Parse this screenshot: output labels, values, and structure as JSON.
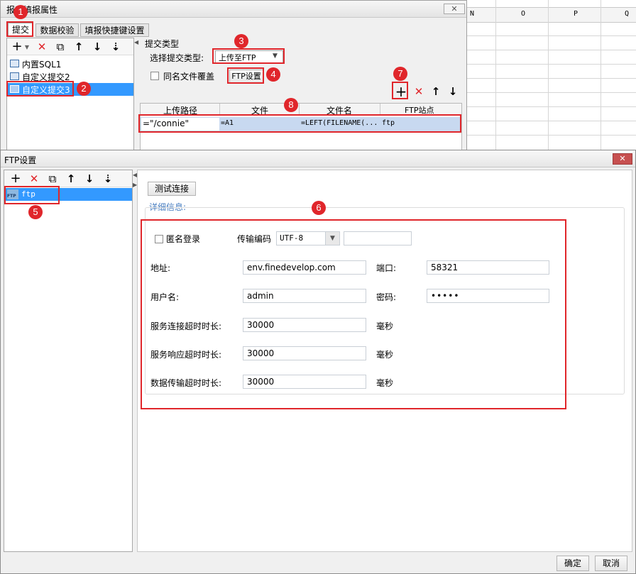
{
  "spreadsheet": {
    "columns": [
      "N",
      "O",
      "P",
      "Q"
    ]
  },
  "prop_dialog": {
    "title": "报表填报属性",
    "tabs": [
      "提交",
      "数据校验",
      "填报快捷键设置"
    ],
    "tree_items": [
      "内置SQL1",
      "自定义提交2",
      "自定义提交3"
    ],
    "section_title": "提交类型",
    "type_label": "选择提交类型:",
    "type_value": "上传至FTP",
    "overwrite_label": "同名文件覆盖",
    "ftp_button": "FTP设置",
    "table_headers": [
      "上传路径",
      "文件",
      "文件名",
      "FTP站点"
    ],
    "row": {
      "path": "=\"/connie\"",
      "file": "=A1",
      "filename": "=LEFT(FILENAME(...",
      "site": "ftp"
    }
  },
  "ftp_dialog": {
    "title": "FTP设置",
    "list_items": [
      {
        "label": "ftp",
        "icon": "ftp-icon"
      }
    ],
    "test_button": "测试连接",
    "detail_title": "详细信息:",
    "anon_label": "匿名登录",
    "encoding_label": "传输编码",
    "encoding_value": "UTF-8",
    "address_label": "地址:",
    "address_value": "env.finedevelop.com",
    "port_label": "端口:",
    "port_value": "58321",
    "user_label": "用户名:",
    "user_value": "admin",
    "password_label": "密码:",
    "password_value": "•••••",
    "connect_timeout_label": "服务连接超时时长:",
    "connect_timeout_value": "30000",
    "response_timeout_label": "服务响应超时时长:",
    "response_timeout_value": "30000",
    "transfer_timeout_label": "数据传输超时时长:",
    "transfer_timeout_value": "30000",
    "unit_label": "毫秒",
    "ok_button": "确定",
    "cancel_button": "取消"
  },
  "callouts": [
    "1",
    "2",
    "3",
    "4",
    "5",
    "6",
    "7",
    "8"
  ],
  "colors": {
    "accent_red": "#e0262b",
    "selection": "#3399ff",
    "row_highlight": "#c8d9f0",
    "link_blue": "#4a7fc1"
  }
}
